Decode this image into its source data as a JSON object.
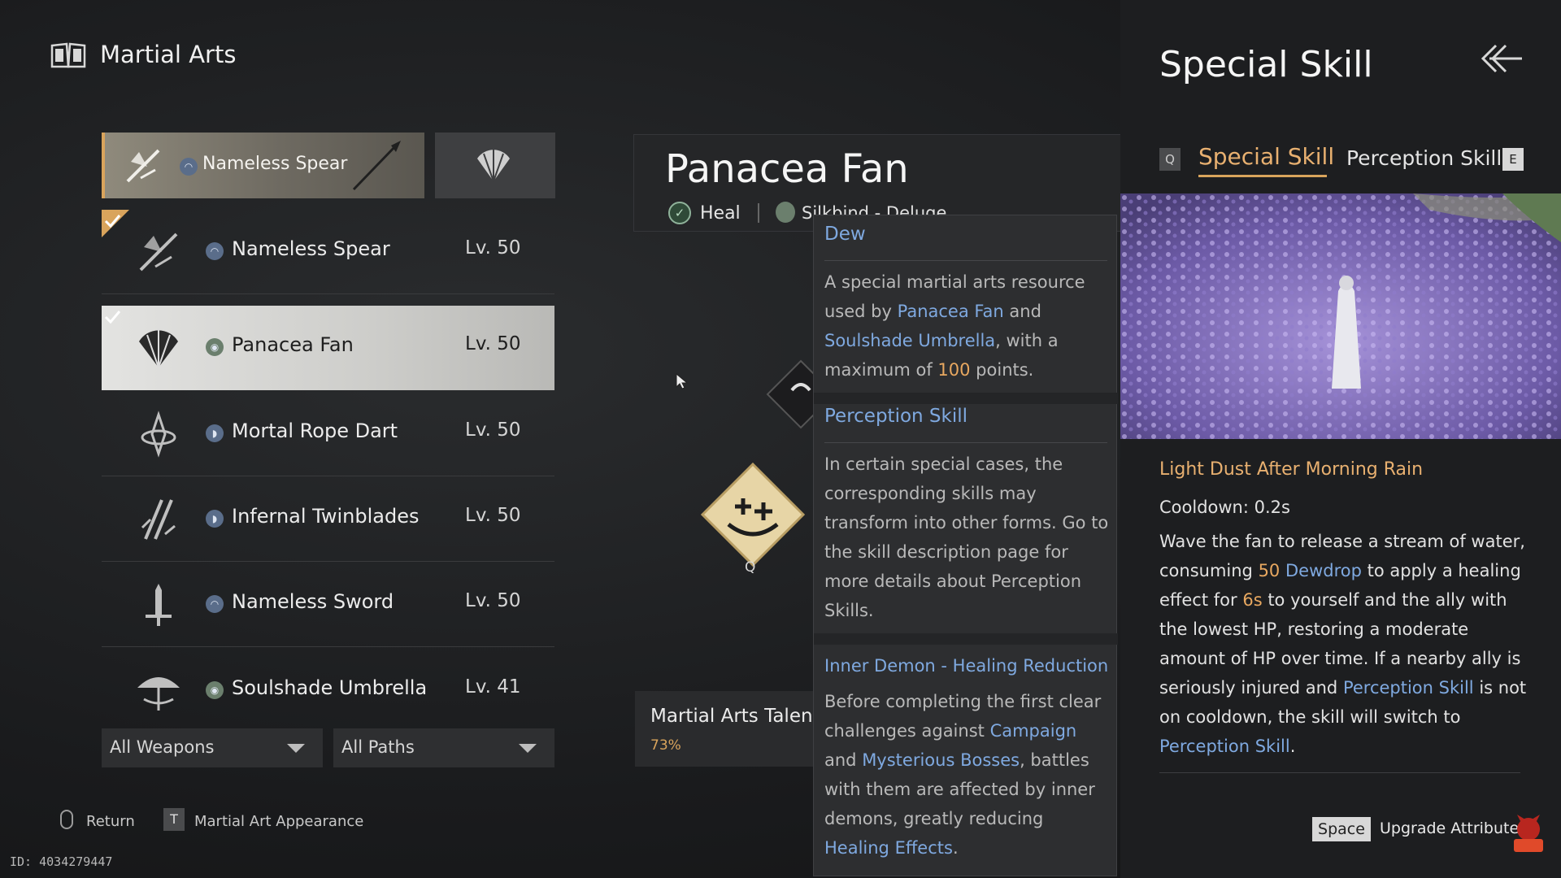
{
  "header": {
    "title": "Martial Arts",
    "icon": "book-icon"
  },
  "equipped": {
    "label": "Nameless Spear",
    "icon": "spear-icon",
    "side_icon": "fan-icon"
  },
  "weapons": [
    {
      "name": "Nameless Spear",
      "level": "Lv. 50",
      "icon": "spear-icon",
      "equipped": true
    },
    {
      "name": "Panacea Fan",
      "level": "Lv. 50",
      "icon": "fan-icon",
      "selected": true
    },
    {
      "name": "Mortal Rope Dart",
      "level": "Lv. 50",
      "icon": "rope-dart-icon"
    },
    {
      "name": "Infernal Twinblades",
      "level": "Lv. 50",
      "icon": "twinblades-icon"
    },
    {
      "name": "Nameless Sword",
      "level": "Lv. 50",
      "icon": "sword-icon"
    },
    {
      "name": "Soulshade Umbrella",
      "level": "Lv. 41",
      "icon": "umbrella-icon"
    }
  ],
  "filters": {
    "weapons": "All Weapons",
    "paths": "All Paths"
  },
  "hints": {
    "return_label": "Return",
    "appearance_key": "T",
    "appearance_label": "Martial Art Appearance"
  },
  "id_text": "ID: 4034279447",
  "center": {
    "title": "Panacea Fan",
    "tag_heal": "Heal",
    "tag_path": "Silkbind - Deluge",
    "skill_key": "Q",
    "talent_title": "Martial Arts Talent",
    "talent_percent": "73%"
  },
  "tooltip": {
    "dew": {
      "title": "Dew",
      "p1": "A special martial arts resource used by ",
      "l1": "Panacea Fan",
      "p2": " and ",
      "l2": "Soulshade Umbrella",
      "p3": ", with a maximum of ",
      "n1": "100",
      "p4": " points."
    },
    "perception": {
      "title": "Perception Skill",
      "body": "In certain special cases, the corresponding skills may transform into other forms. Go to the skill description page for more details about Perception Skills."
    },
    "inner_demon": {
      "title": "Inner Demon - Healing Reduction",
      "p1": "Before completing the first clear challenges against ",
      "l1": "Campaign",
      "p2": " and ",
      "l2": "Mysterious Bosses",
      "p3": ", battles with them are affected by inner demons, greatly reducing ",
      "l3": "Healing Effects",
      "p4": "."
    }
  },
  "right_panel": {
    "title": "Special Skill",
    "tab_q_key": "Q",
    "tab_special": "Special Skill",
    "tab_perception": "Perception Skill",
    "tab_e_key": "E",
    "skill_name": "Light Dust After Morning Rain",
    "cooldown": "Cooldown: 0.2s",
    "desc": {
      "p1": " Wave the fan to release a stream of water, consuming ",
      "n1": "50",
      "l1": " Dewdrop",
      "p2": " to apply a healing effect for ",
      "n2": "6s",
      "p3": " to yourself and the ally with the lowest HP, restoring a moderate amount of HP over time. If a nearby ally is seriously injured and ",
      "l2": "Perception Skill",
      "p4": " is not on cooldown, the skill will switch to ",
      "l3": "Perception Skill",
      "p5": "."
    },
    "space_key": "Space",
    "upgrade_label": "Upgrade Attributes"
  },
  "colors": {
    "accent": "#d9a45c",
    "link": "#7fa9e0",
    "number": "#e8a860"
  }
}
